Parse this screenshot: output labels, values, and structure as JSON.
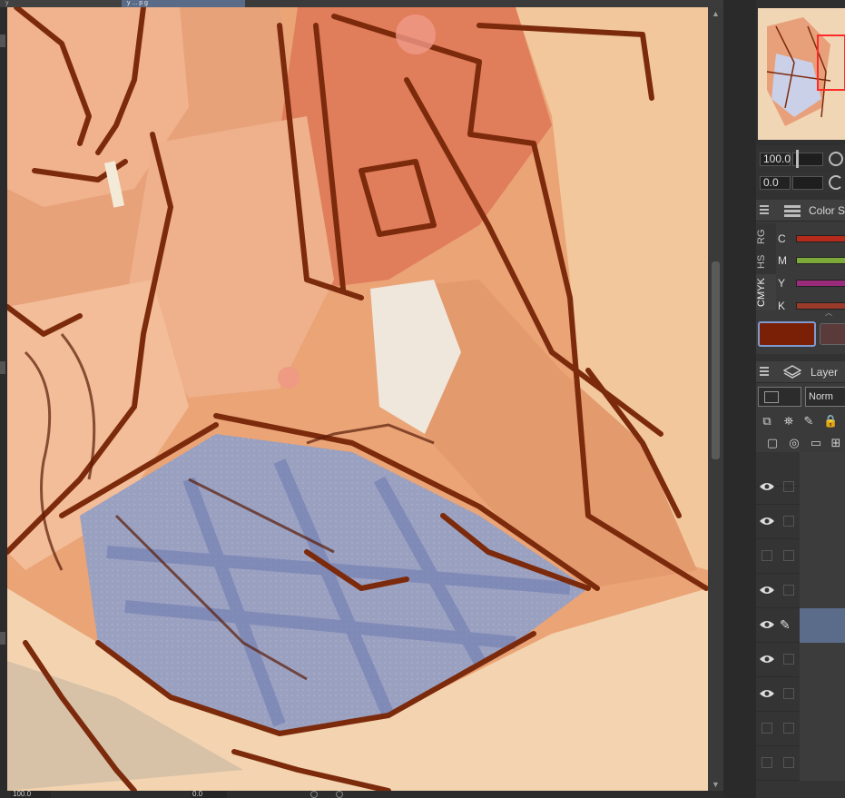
{
  "tabs": [
    {
      "label": "y"
    },
    {
      "label": "y ... p g"
    }
  ],
  "status": {
    "zoom": "100.0",
    "rotation": "0.0"
  },
  "navigator": {
    "zoom": "100.0",
    "rotation": "0.0"
  },
  "color_panel": {
    "title": "Color S",
    "modes": [
      "RG",
      "HS",
      "CMYK"
    ],
    "sliders": [
      {
        "label": "C",
        "color": "#b52a1a"
      },
      {
        "label": "M",
        "color": "#7ca93a"
      },
      {
        "label": "Y",
        "color": "#9a2b7a"
      },
      {
        "label": "K",
        "color": "#9a3a2a"
      }
    ],
    "main_color": "#7a2006",
    "sub_color": "#5a3a3a"
  },
  "layer_panel": {
    "title": "Layer",
    "blend_mode": "Norm",
    "layers": [
      {
        "visible": true,
        "kind": "folder"
      },
      {
        "visible": true,
        "kind": "raster"
      },
      {
        "visible": false,
        "kind": "raster"
      },
      {
        "visible": true,
        "kind": "raster"
      },
      {
        "visible": true,
        "kind": "raster",
        "selected": true
      },
      {
        "visible": true,
        "kind": "raster"
      },
      {
        "visible": true,
        "kind": "raster"
      },
      {
        "visible": false,
        "kind": "raster"
      },
      {
        "visible": false,
        "kind": "raster"
      }
    ]
  }
}
